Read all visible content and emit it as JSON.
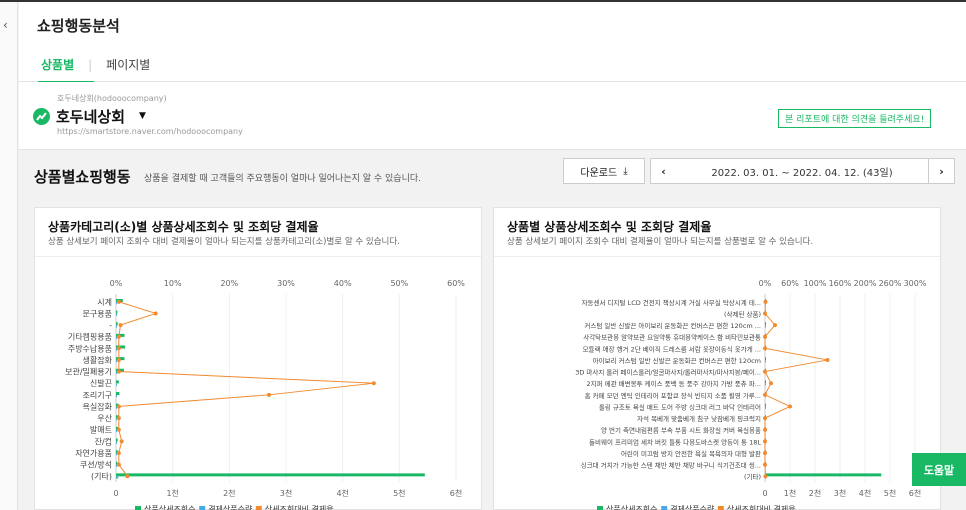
{
  "page": {
    "title": "쇼핑행동분석",
    "collapse_icon": "chevron-left-icon"
  },
  "tabs": [
    {
      "label": "상품별",
      "active": true
    },
    {
      "label": "페이지별",
      "active": false
    }
  ],
  "store": {
    "sub_label": "호두네상회(hodooocompany)",
    "name": "호두네상회",
    "url": "https://smartstore.naver.com/hodooocompany",
    "feedback_button": "본 리포트에 대한 의견을 들려주세요!"
  },
  "section": {
    "title": "상품별쇼핑행동",
    "description": "상품을 결제할 때 고객들의 주요행동이 얼마나 일어나는지 알 수 있습니다.",
    "download_label": "다운로드",
    "date_range": "2022. 03. 01. ~ 2022. 04. 12. (43일)",
    "prev_icon": "chevron-left-icon",
    "next_icon": "chevron-right-icon"
  },
  "help_button": "도움말",
  "colors": {
    "green": "#19b865",
    "blue": "#4aa8e8",
    "orange": "#f28a2e"
  },
  "chart_data": [
    {
      "type": "bar",
      "title": "상품카테고리(소)별 상품상세조회수 및 조회당 결제율",
      "subtitle": "상품 상세보기 페이지 조회수 대비 결제율이 얼마나 되는지를 상품카테고리(소)별로 알 수 있습니다.",
      "categories": [
        "시계",
        "문구용품",
        "-",
        "기타캠핑용품",
        "주방수납용품",
        "생활잡화",
        "보관/밀폐용기",
        "신발끈",
        "조리기구",
        "욕실잡화",
        "우산",
        "발매트",
        "잔/컵",
        "자연가용품",
        "쿠션/방석",
        "(기타)"
      ],
      "x_ticks": [
        "0",
        "1천",
        "2천",
        "3천",
        "4천",
        "5천",
        "6천"
      ],
      "x_max": 6000,
      "top_ticks": [
        "0%",
        "10%",
        "20%",
        "30%",
        "40%",
        "50%",
        "60%"
      ],
      "top_max": 60,
      "series": [
        {
          "name": "상품상세조회수",
          "values": [
            120,
            25,
            30,
            150,
            160,
            150,
            140,
            50,
            60,
            45,
            45,
            35,
            30,
            30,
            25,
            5450
          ]
        },
        {
          "name": "결제상품수량",
          "values": [
            2,
            1,
            1,
            2,
            3,
            3,
            2,
            1,
            1,
            1,
            1,
            1,
            1,
            1,
            1,
            40
          ]
        },
        {
          "name": "상세조회대비 결제율",
          "values": [
            0.5,
            7.0,
            0.8,
            0.5,
            0.5,
            0.5,
            0.5,
            45.5,
            27.0,
            0.5,
            0.5,
            0.5,
            1.0,
            0.5,
            0.5,
            2.0
          ]
        }
      ],
      "legend": [
        "상품상세조회수",
        "결제상품수량",
        "상세조회대비 결제율"
      ]
    },
    {
      "type": "bar",
      "title": "상품별 상품상세조회수 및 조회당 결제율",
      "subtitle": "상품 상세보기 페이지 조회수 대비 결제율이 얼마나 되는지를 상품별로 알 수 있습니다.",
      "categories": [
        "자동센서 디지털 LCD 건전지 책상시계 거실 사무실 탁상시계 테...",
        "(삭제된 상품)",
        "커스텀 일반 신발끈 아이보리 운동화끈 컨버스끈 편한 120cm ...",
        "사각탁보관용 알약보관 요일약통 휴대용약케이스 함 비타민보관통",
        "모듈랙 애장 행거 2단 베이직 드레스룸 서랍 옷장이동식 옷가게 ...",
        "아이보리 커스텀 일반 신발끈 운동화끈 컨버스끈 편한 120cm",
        "3D 마사지 롤러 페이스롤러/얼굴마사지/롤러마사지/마사지봉/페이...",
        "2지퍼 메관 배변봉투 케이스 풍백 동 풍주 강아지 가방 풍츄 파...",
        "홈 카페 모던 엔틱 인테리어 포함쿄 장식 빈티지 소품 횔영 가루...",
        "롤링 규조토 욕실 매트 도어 주방 싱크대 러그 바닥 인테리어",
        "자석 목베개 맞춤베개 침구 낮잠베개 핑크럭지",
        "양 번기 측면내림편릅 부속 부품 시트 화장실 커버 욕실용품",
        "돌비웨이 프리미엄 세차 버킷 틀통 다용도바스켓 양동이 통 18L",
        "어린이 미끄럼 방지 안전한 욕실 목욕의자 대형 발판",
        "싱크대 거치가 가능한 스텐 채반 체반 채망 바구니 식기건조대 씽...",
        "(기타)"
      ],
      "x_ticks": [
        "0",
        "1천",
        "2천",
        "3천",
        "4천",
        "5천",
        "6천"
      ],
      "x_max": 6000,
      "top_ticks": [
        "0%",
        "60%",
        "100%",
        "160%",
        "200%",
        "260%",
        "300%"
      ],
      "top_max": 300,
      "series": [
        {
          "name": "상품상세조회수",
          "values": [
            15,
            10,
            20,
            15,
            20,
            10,
            10,
            10,
            10,
            10,
            10,
            10,
            10,
            10,
            10,
            4650
          ]
        },
        {
          "name": "결제상품수량",
          "values": [
            1,
            1,
            1,
            1,
            1,
            1,
            1,
            1,
            1,
            1,
            1,
            1,
            1,
            1,
            1,
            30
          ]
        },
        {
          "name": "상세조회대비 결제율",
          "values": [
            1,
            0,
            20,
            0,
            0,
            125,
            0,
            12,
            0,
            50,
            0,
            0,
            0,
            0,
            0,
            1
          ]
        }
      ],
      "legend": [
        "상품상세조회수",
        "결제상품수량",
        "상세조회대비 결제율"
      ]
    }
  ]
}
